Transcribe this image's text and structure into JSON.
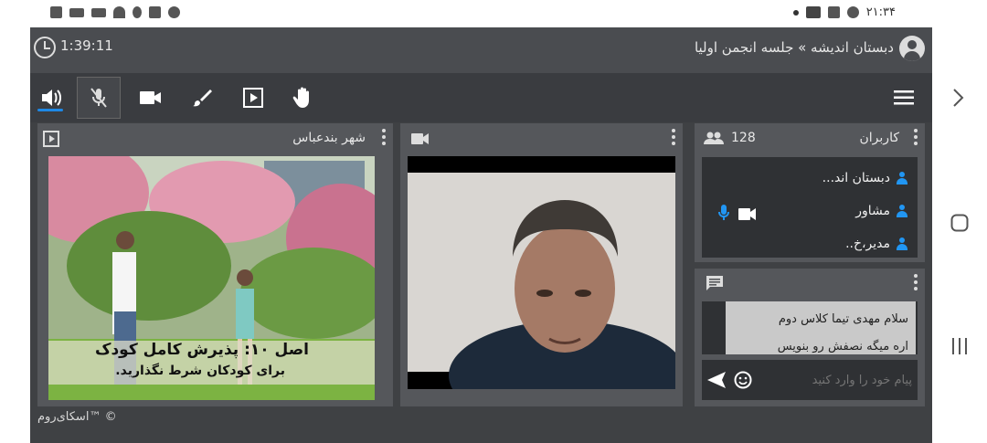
{
  "statusbar": {
    "time": "۲۱:۳۴"
  },
  "header": {
    "timer": "1:39:11",
    "title": "دبستان اندیشه » جلسه انجمن اولیا"
  },
  "toolbar": {
    "icons": [
      "speaker-icon",
      "mic-off-icon",
      "camera-icon",
      "brush-icon",
      "play-icon",
      "hand-icon",
      "menu-icon"
    ]
  },
  "presentation": {
    "title": "شهر بندعباس",
    "slide_title": "اصل ۱۰: پذیرش کامل کودک",
    "slide_subtitle": "برای کودکان شرط نگذارید."
  },
  "users": {
    "title": "کاربران",
    "count": "128",
    "list": [
      {
        "name": "دبستان اند..."
      },
      {
        "name": "مشاور"
      },
      {
        "name": "مدیر،خ.."
      }
    ]
  },
  "chat": {
    "message_line1": "سلام مهدی تیما کلاس دوم",
    "message_line2": "اره میگه نصفش رو بنویس",
    "input_placeholder": "پیام خود را وارد کنید"
  },
  "footer": {
    "brand": "اسکای‌روم™ ©"
  },
  "colors": {
    "accent": "#1e88e5",
    "panel": "#55575b",
    "background": "#3f4144"
  }
}
